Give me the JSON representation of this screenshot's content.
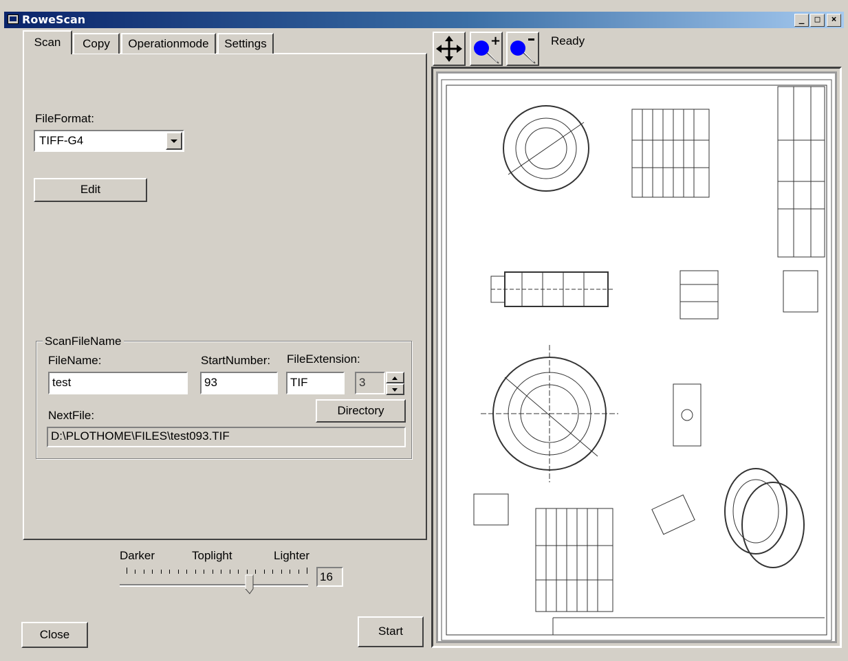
{
  "window": {
    "title": "RoweScan",
    "min_label": "_",
    "max_label": "□",
    "close_label": "×"
  },
  "tabs": [
    {
      "label": "Scan",
      "active": true
    },
    {
      "label": "Copy",
      "active": false
    },
    {
      "label": "Operationmode",
      "active": false
    },
    {
      "label": "Settings",
      "active": false
    }
  ],
  "scan": {
    "file_format_label": "FileFormat:",
    "file_format_value": "TIFF-G4",
    "edit_label": "Edit",
    "group_title": "ScanFileName",
    "filename_label": "FileName:",
    "filename_value": "test",
    "start_number_label": "StartNumber:",
    "start_number_value": "93",
    "file_extension_label": "FileExtension:",
    "file_extension_value": "TIF",
    "digits_value": "3",
    "directory_label": "Directory",
    "next_file_label": "NextFile:",
    "next_file_value": "D:\\PLOTHOME\\FILES\\test093.TIF"
  },
  "toplight": {
    "darker_label": "Darker",
    "title": "Toplight",
    "lighter_label": "Lighter",
    "value": "16",
    "level_fraction": 0.7
  },
  "buttons": {
    "close_label": "Close",
    "start_label": "Start"
  },
  "toolbar": {
    "status": "Ready",
    "icons": [
      "move-arrows-icon",
      "zoom-in-icon",
      "zoom-out-icon"
    ]
  },
  "colors": {
    "titlebar_start": "#0a246a",
    "titlebar_end": "#a6caf0",
    "zoom_dot": "#0000ff",
    "face": "#d4d0c8"
  }
}
